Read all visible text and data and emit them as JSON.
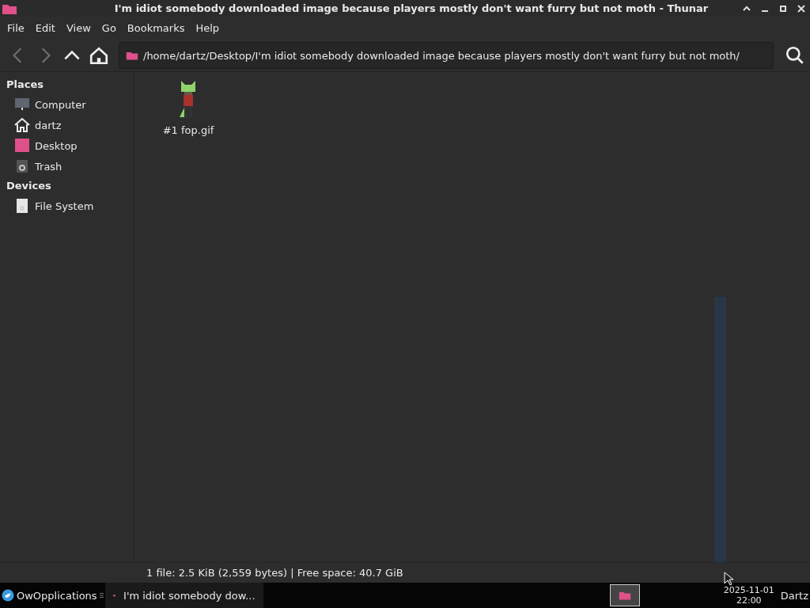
{
  "window": {
    "title": "I'm idiot somebody downloaded image because players mostly don't want furry but not moth - Thunar"
  },
  "menu": [
    "File",
    "Edit",
    "View",
    "Go",
    "Bookmarks",
    "Help"
  ],
  "toolbar": {
    "back_disabled": true,
    "forward_disabled": true,
    "location": "/home/dartz/Desktop/I'm idiot somebody downloaded image because players mostly don't want furry but not moth/"
  },
  "sidebar": {
    "sections": [
      {
        "title": "Places",
        "items": [
          {
            "label": "Computer",
            "kind": "computer",
            "selected": false
          },
          {
            "label": "dartz",
            "kind": "home",
            "selected": false
          },
          {
            "label": "Desktop",
            "kind": "desktop",
            "selected": false
          },
          {
            "label": "Trash",
            "kind": "trash",
            "selected": false
          }
        ]
      },
      {
        "title": "Devices",
        "items": [
          {
            "label": "File System",
            "kind": "drive",
            "selected": false
          }
        ]
      }
    ]
  },
  "files": [
    {
      "name": "#1 fop.gif",
      "selected": false
    }
  ],
  "status_bar": "1 file: 2.5 KiB (2,559 bytes)  |  Free space: 40.7 GiB",
  "taskbar": {
    "menu_label": "OwOpplications",
    "tasks": [
      {
        "label": "I'm idiot somebody dow...",
        "selected": false
      }
    ],
    "date": "2025-11-01",
    "time": "22:00",
    "user": "Dartz"
  }
}
